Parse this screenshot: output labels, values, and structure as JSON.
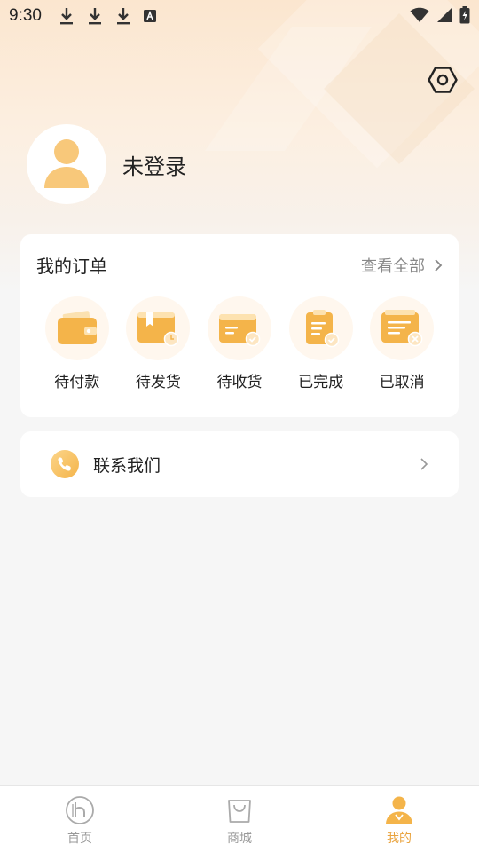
{
  "status_bar": {
    "time": "9:30",
    "icons": [
      "download-icon",
      "download-icon",
      "download-icon",
      "font-a-icon",
      "wifi-icon",
      "signal-icon",
      "battery-charging-icon"
    ]
  },
  "header": {
    "settings_icon": "hexagon-settings-icon"
  },
  "profile": {
    "username": "未登录",
    "avatar_icon": "user-avatar-icon"
  },
  "orders": {
    "title": "我的订单",
    "view_all": "查看全部",
    "items": [
      {
        "label": "待付款",
        "icon": "wallet-icon"
      },
      {
        "label": "待发货",
        "icon": "package-clock-icon"
      },
      {
        "label": "待收货",
        "icon": "card-check-icon"
      },
      {
        "label": "已完成",
        "icon": "clipboard-check-icon"
      },
      {
        "label": "已取消",
        "icon": "receipt-cancel-icon"
      }
    ]
  },
  "contact": {
    "label": "联系我们",
    "icon": "phone-icon"
  },
  "tabbar": {
    "tabs": [
      {
        "label": "首页",
        "icon": "home-logo-icon",
        "active": false
      },
      {
        "label": "商城",
        "icon": "shopping-bag-icon",
        "active": false
      },
      {
        "label": "我的",
        "icon": "profile-icon",
        "active": true
      }
    ]
  },
  "colors": {
    "accent": "#e9a33e",
    "icon_gold": "#f4b44a",
    "page_bg": "#f6f6f6"
  }
}
